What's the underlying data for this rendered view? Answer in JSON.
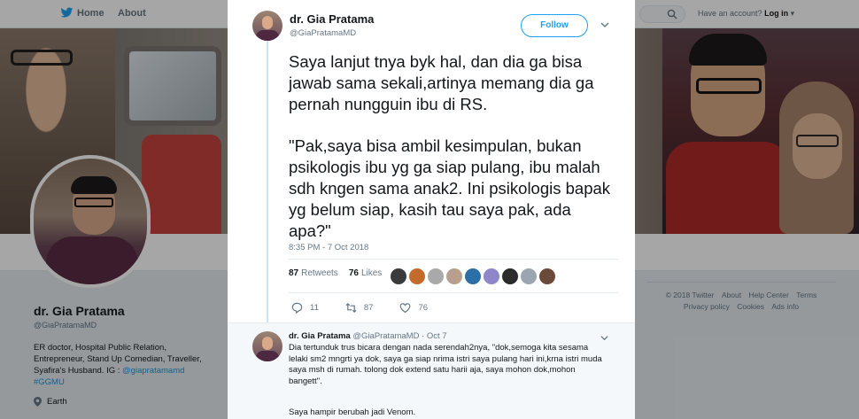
{
  "nav": {
    "home_label": "Home",
    "about_label": "About",
    "have_account": "Have an account?",
    "login_label": "Log in"
  },
  "profile": {
    "name": "dr. Gia Pratama",
    "handle": "@GiaPratamaMD",
    "bio_line1": "ER doctor, Hospital Public Relation,",
    "bio_line2": "Entrepreneur, Stand Up Comedian, Traveller,",
    "bio_line3_prefix": "Syafira's Husband. IG : ",
    "bio_ig": "@giapratamamd",
    "bio_tag": "#GGMU",
    "location": "Earth"
  },
  "footer": {
    "row1": [
      "© 2018 Twitter",
      "About",
      "Help Center",
      "Terms"
    ],
    "row2": [
      "Privacy policy",
      "Cookies",
      "Ads info"
    ]
  },
  "tweet": {
    "author_name": "dr. Gia Pratama",
    "author_handle": "@GiaPratamaMD",
    "follow_label": "Follow",
    "paragraph1": "Saya lanjut tnya byk hal, dan dia ga bisa jawab sama sekali,artinya memang dia ga pernah nungguin ibu di RS.",
    "paragraph2": "\"Pak,saya bisa ambil kesimpulan, bukan psikologis ibu yg ga siap pulang, ibu malah sdh kngen sama anak2. Ini psikologis bapak yg belum siap, kasih tau saya pak, ada apa?\"",
    "timestamp": "8:35 PM - 7 Oct 2018",
    "retweets_count": "87",
    "retweets_label": "Retweets",
    "likes_count": "76",
    "likes_label": "Likes",
    "liker_colors": [
      "#3a3a3a",
      "#c46a2d",
      "#a9a9a9",
      "#b89f8d",
      "#2c6fa8",
      "#8e87c9",
      "#2b2b2b",
      "#9aa5b1",
      "#6b4a3a"
    ],
    "reply_count": "11",
    "retweet_action_count": "87",
    "like_action_count": "76"
  },
  "reply": {
    "author_name": "dr. Gia Pratama",
    "author_handle": "@GiaPratamaMD",
    "date": "· Oct 7",
    "text": "Dia tertunduk trus bicara dengan nada serendah2nya, \"dok,semoga kita sesama lelaki sm2 mngrti ya dok, saya ga siap nrima istri saya pulang hari ini,krna istri muda saya msh di rumah. tolong dok extend satu harii aja, saya mohon dok,mohon bangett\".",
    "text2": "Saya hampir berubah jadi Venom."
  },
  "colors": {
    "accent": "#1da1f2",
    "link": "#1b95e0"
  }
}
